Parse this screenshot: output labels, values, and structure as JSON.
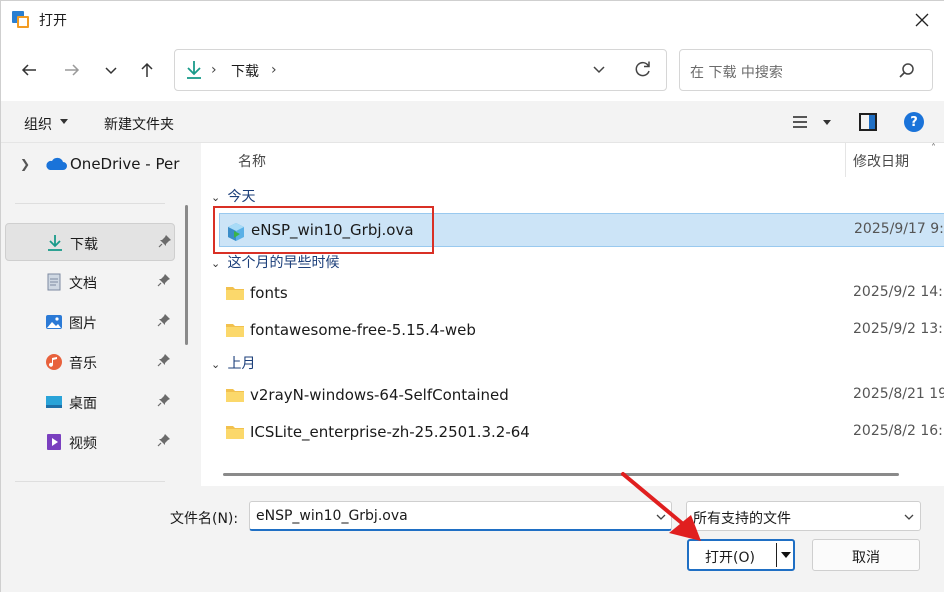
{
  "window": {
    "title": "打开"
  },
  "address": {
    "folder": "下载",
    "separator": "›"
  },
  "search": {
    "placeholder": "在 下载 中搜索"
  },
  "toolbar": {
    "organize": "组织",
    "new_folder": "新建文件夹"
  },
  "sidebar": {
    "onedrive": "OneDrive - Per",
    "items": [
      {
        "label": "下载",
        "icon": "download-icon",
        "selected": true
      },
      {
        "label": "文档",
        "icon": "document-icon"
      },
      {
        "label": "图片",
        "icon": "pictures-icon"
      },
      {
        "label": "音乐",
        "icon": "music-icon"
      },
      {
        "label": "桌面",
        "icon": "desktop-icon"
      },
      {
        "label": "视频",
        "icon": "video-icon"
      }
    ]
  },
  "columns": {
    "name": "名称",
    "date": "修改日期"
  },
  "groups": [
    {
      "label": "今天"
    },
    {
      "label": "这个月的早些时候"
    },
    {
      "label": "上月"
    }
  ],
  "files": [
    {
      "name": "eNSP_win10_Grbj.ova",
      "date": "2025/9/17 9:",
      "type": "ova",
      "selected": true
    },
    {
      "name": "fonts",
      "date": "2025/9/2 14:",
      "type": "folder"
    },
    {
      "name": "fontawesome-free-5.15.4-web",
      "date": "2025/9/2 13:",
      "type": "folder"
    },
    {
      "name": "v2rayN-windows-64-SelfContained",
      "date": "2025/8/21 19",
      "type": "folder"
    },
    {
      "name": "ICSLite_enterprise-zh-25.2501.3.2-64",
      "date": "2025/8/2 16:",
      "type": "folder"
    }
  ],
  "footer": {
    "filename_label": "文件名(N):",
    "filename_value": "eNSP_win10_Grbj.ova",
    "filetype_value": "所有支持的文件",
    "open_label": "打开(O)",
    "cancel_label": "取消"
  },
  "colors": {
    "accent": "#1f6fc4",
    "selection": "#cce4f7",
    "annotation": "#d93025"
  }
}
